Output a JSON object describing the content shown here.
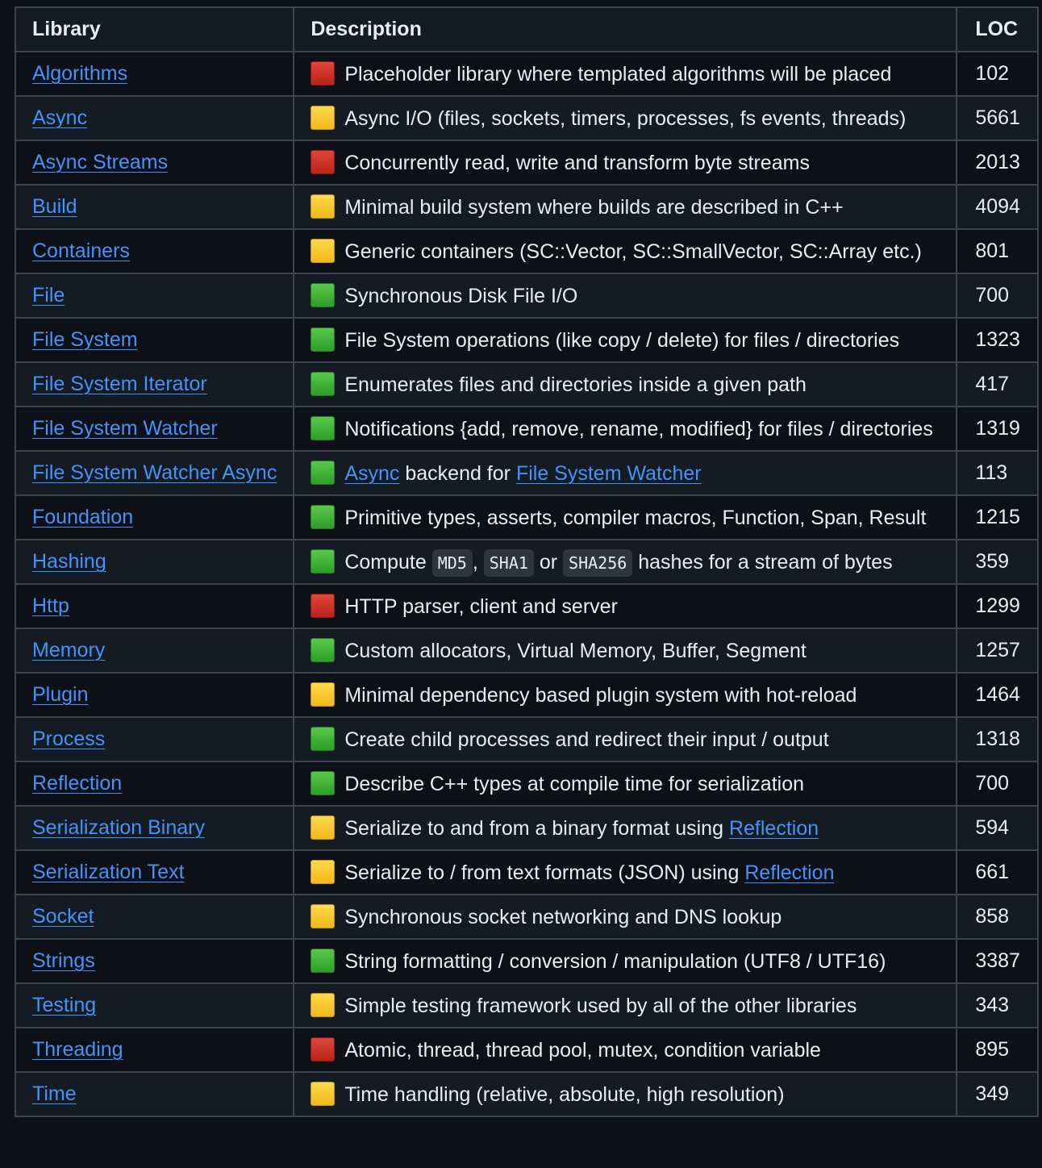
{
  "colors": {
    "background": "#0d1117",
    "row_alt": "#151b23",
    "border": "#3d444d",
    "text": "#e6edf3",
    "link": "#4493f8",
    "status_red": "#d0342c",
    "status_yellow": "#fbcb2e",
    "status_green": "#43b13a"
  },
  "table": {
    "headers": {
      "library": "Library",
      "description": "Description",
      "loc": "LOC"
    },
    "rows": [
      {
        "library": "Algorithms",
        "status": "red",
        "desc": [
          {
            "t": "Placeholder library where templated algorithms will be placed"
          }
        ],
        "loc": "102"
      },
      {
        "library": "Async",
        "status": "yellow",
        "desc": [
          {
            "t": "Async I/O (files, sockets, timers, processes, fs events, threads)"
          }
        ],
        "loc": "5661"
      },
      {
        "library": "Async Streams",
        "status": "red",
        "desc": [
          {
            "t": "Concurrently read, write and transform byte streams"
          }
        ],
        "loc": "2013"
      },
      {
        "library": "Build",
        "status": "yellow",
        "desc": [
          {
            "t": "Minimal build system where builds are described in C++"
          }
        ],
        "loc": "4094"
      },
      {
        "library": "Containers",
        "status": "yellow",
        "desc": [
          {
            "t": "Generic containers (SC::Vector, SC::SmallVector, SC::Array etc.)"
          }
        ],
        "loc": "801"
      },
      {
        "library": "File",
        "status": "green",
        "desc": [
          {
            "t": "Synchronous Disk File I/O"
          }
        ],
        "loc": "700"
      },
      {
        "library": "File System",
        "status": "green",
        "desc": [
          {
            "t": "File System operations (like copy / delete) for files / directories"
          }
        ],
        "loc": "1323"
      },
      {
        "library": "File System Iterator",
        "status": "green",
        "desc": [
          {
            "t": "Enumerates files and directories inside a given path"
          }
        ],
        "loc": "417"
      },
      {
        "library": "File System Watcher",
        "status": "green",
        "desc": [
          {
            "t": "Notifications {add, remove, rename, modified} for files / directories"
          }
        ],
        "loc": "1319"
      },
      {
        "library": "File System Watcher Async",
        "status": "green",
        "desc": [
          {
            "link": "Async"
          },
          {
            "t": " backend for "
          },
          {
            "link": "File System Watcher"
          }
        ],
        "loc": "113"
      },
      {
        "library": "Foundation",
        "status": "green",
        "desc": [
          {
            "t": "Primitive types, asserts, compiler macros, Function, Span, Result"
          }
        ],
        "loc": "1215"
      },
      {
        "library": "Hashing",
        "status": "green",
        "desc": [
          {
            "t": "Compute "
          },
          {
            "code": "MD5"
          },
          {
            "t": ", "
          },
          {
            "code": "SHA1"
          },
          {
            "t": " or "
          },
          {
            "code": "SHA256"
          },
          {
            "t": " hashes for a stream of bytes"
          }
        ],
        "loc": "359"
      },
      {
        "library": "Http",
        "status": "red",
        "desc": [
          {
            "t": "HTTP parser, client and server"
          }
        ],
        "loc": "1299"
      },
      {
        "library": "Memory",
        "status": "green",
        "desc": [
          {
            "t": "Custom allocators, Virtual Memory, Buffer, Segment"
          }
        ],
        "loc": "1257"
      },
      {
        "library": "Plugin",
        "status": "yellow",
        "desc": [
          {
            "t": "Minimal dependency based plugin system with hot-reload"
          }
        ],
        "loc": "1464"
      },
      {
        "library": "Process",
        "status": "green",
        "desc": [
          {
            "t": "Create child processes and redirect their input / output"
          }
        ],
        "loc": "1318"
      },
      {
        "library": "Reflection",
        "status": "green",
        "desc": [
          {
            "t": "Describe C++ types at compile time for serialization"
          }
        ],
        "loc": "700"
      },
      {
        "library": "Serialization Binary",
        "status": "yellow",
        "desc": [
          {
            "t": "Serialize to and from a binary format using "
          },
          {
            "link": "Reflection"
          }
        ],
        "loc": "594"
      },
      {
        "library": "Serialization Text",
        "status": "yellow",
        "desc": [
          {
            "t": "Serialize to / from text formats (JSON) using "
          },
          {
            "link": "Reflection"
          }
        ],
        "loc": "661"
      },
      {
        "library": "Socket",
        "status": "yellow",
        "desc": [
          {
            "t": "Synchronous socket networking and DNS lookup"
          }
        ],
        "loc": "858"
      },
      {
        "library": "Strings",
        "status": "green",
        "desc": [
          {
            "t": "String formatting / conversion / manipulation (UTF8 / UTF16)"
          }
        ],
        "loc": "3387"
      },
      {
        "library": "Testing",
        "status": "yellow",
        "desc": [
          {
            "t": "Simple testing framework used by all of the other libraries"
          }
        ],
        "loc": "343"
      },
      {
        "library": "Threading",
        "status": "red",
        "desc": [
          {
            "t": "Atomic, thread, thread pool, mutex, condition variable"
          }
        ],
        "loc": "895"
      },
      {
        "library": "Time",
        "status": "yellow",
        "desc": [
          {
            "t": "Time handling (relative, absolute, high resolution)"
          }
        ],
        "loc": "349"
      }
    ]
  }
}
